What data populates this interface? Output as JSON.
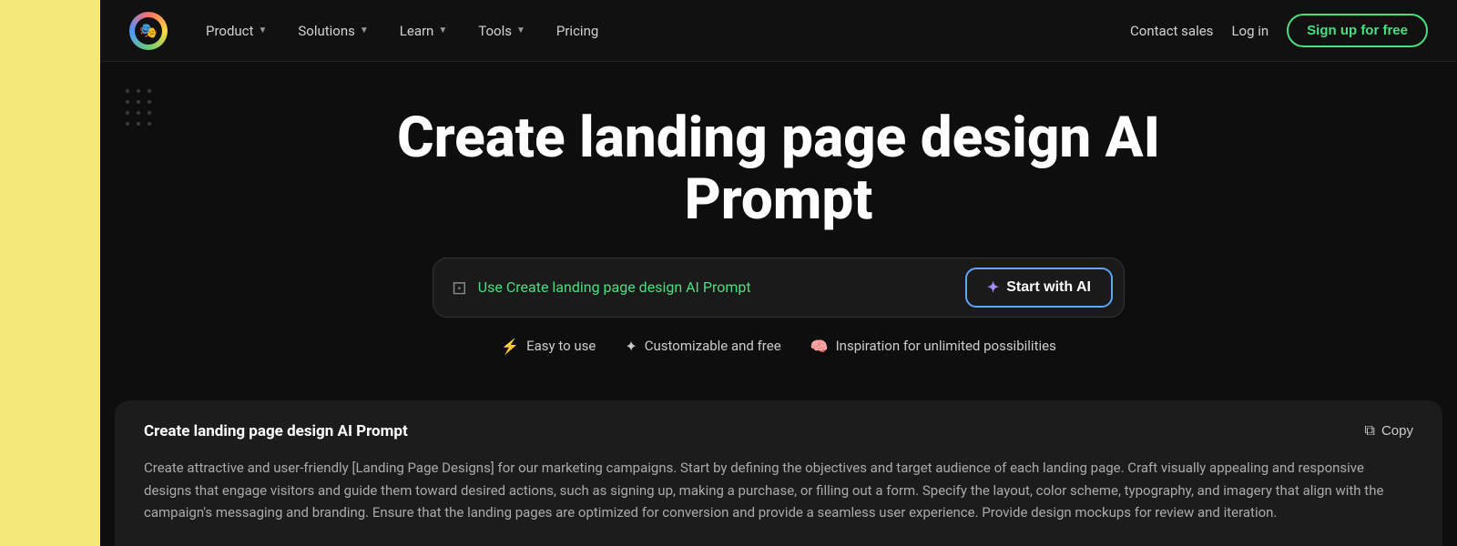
{
  "nav": {
    "logo_emoji": "🎭",
    "items": [
      {
        "label": "Product",
        "has_dropdown": true
      },
      {
        "label": "Solutions",
        "has_dropdown": true
      },
      {
        "label": "Learn",
        "has_dropdown": true
      },
      {
        "label": "Tools",
        "has_dropdown": true
      },
      {
        "label": "Pricing",
        "has_dropdown": false
      }
    ],
    "contact_sales": "Contact sales",
    "login": "Log in",
    "signup": "Sign up for free"
  },
  "hero": {
    "title": "Create landing page design AI Prompt",
    "prompt_placeholder": "Use Create landing page design AI Prompt",
    "start_btn": "Start with AI",
    "start_btn_icon": "✦",
    "features": [
      {
        "icon": "⚡",
        "label": "Easy to use"
      },
      {
        "icon": "✦",
        "label": "Customizable and free"
      },
      {
        "icon": "🧠",
        "label": "Inspiration for unlimited possibilities"
      }
    ]
  },
  "bottom_card": {
    "title": "Create landing page design AI Prompt",
    "copy_label": "Copy",
    "body": "Create attractive and user-friendly [Landing Page Designs] for our marketing campaigns. Start by defining the objectives and target audience of each landing page. Craft visually appealing and responsive designs that engage visitors and guide them toward desired actions, such as signing up, making a purchase, or filling out a form. Specify the layout, color scheme, typography, and imagery that align with the campaign's messaging and branding. Ensure that the landing pages are optimized for conversion and provide a seamless user experience. Provide design mockups for review and iteration."
  },
  "colors": {
    "accent_green": "#4ade80",
    "accent_blue": "#60a5fa",
    "accent_purple": "#a78bfa",
    "bg_dark": "#0e0e0e",
    "bg_yellow": "#f5e87a"
  }
}
